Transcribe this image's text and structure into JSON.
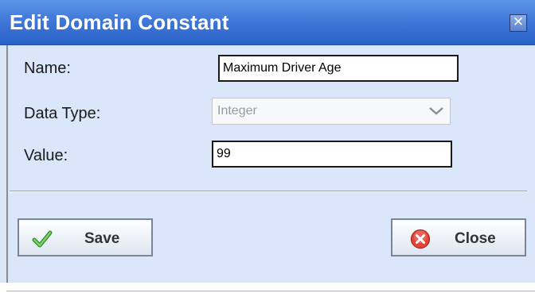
{
  "dialog": {
    "title": "Edit Domain Constant",
    "close_glyph": "✕",
    "close_icon": "close-icon"
  },
  "form": {
    "name_label": "Name:",
    "name_value": "Maximum Driver Age",
    "data_type_label": "Data Type:",
    "data_type_value": "Integer",
    "data_type_enabled": false,
    "value_label": "Value:",
    "value_value": "99"
  },
  "buttons": {
    "save_label": "Save",
    "save_icon": "checkmark-icon",
    "close_label": "Close",
    "close_icon": "cancel-icon"
  },
  "colors": {
    "titlebar": "#3f78d8",
    "dialog_background": "#dae7fa",
    "check_green": "#3fae3f",
    "cancel_red": "#e0453c"
  }
}
